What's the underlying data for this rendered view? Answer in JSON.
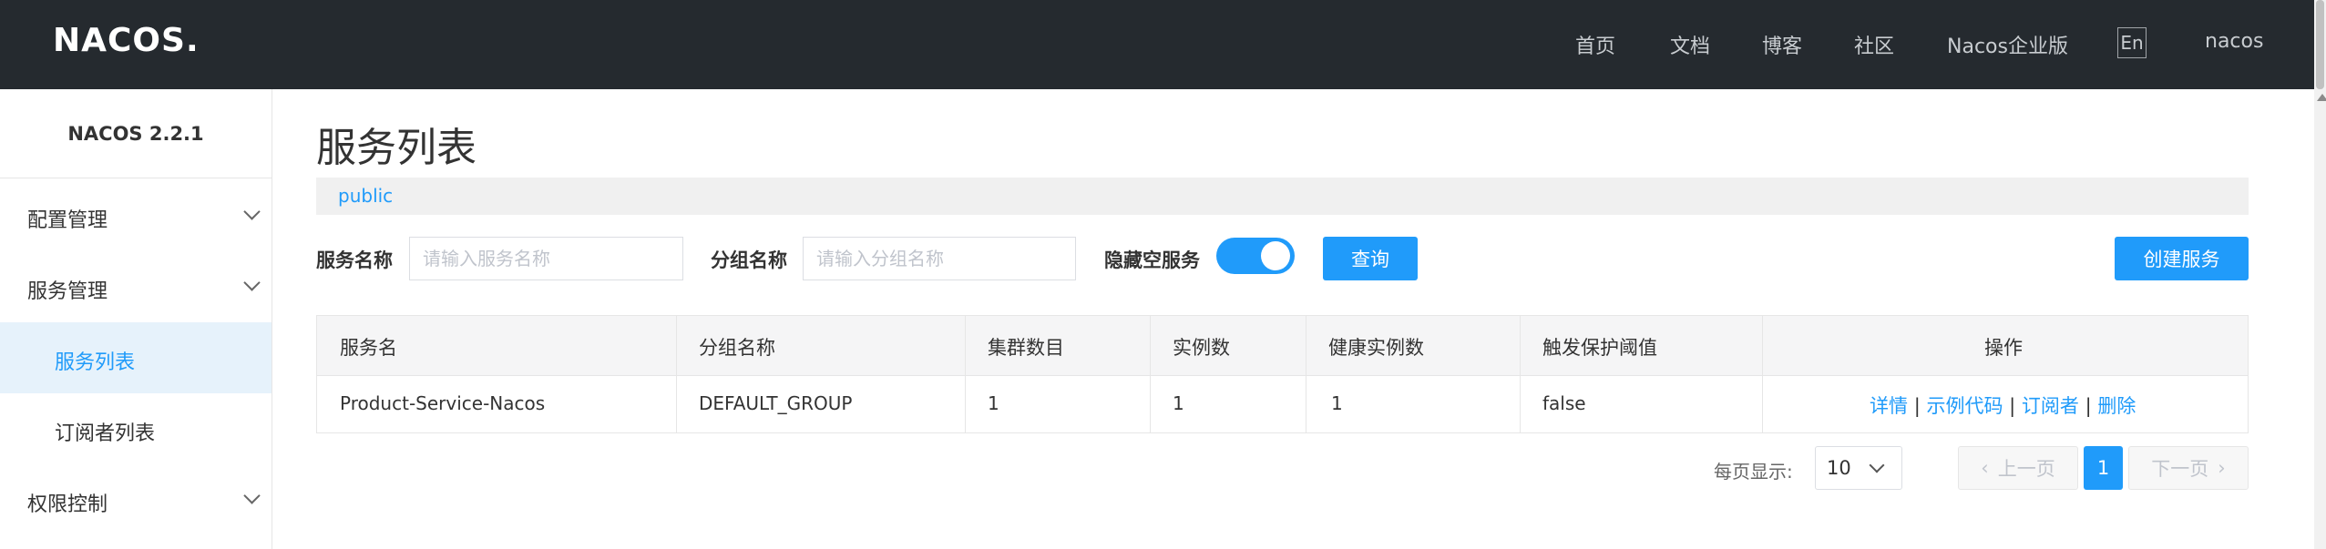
{
  "header": {
    "logo": "NACOS.",
    "nav": [
      "首页",
      "文档",
      "博客",
      "社区",
      "Nacos企业版"
    ],
    "lang": "En",
    "user": "nacos"
  },
  "sidebar": {
    "version": "NACOS 2.2.1",
    "items": [
      {
        "label": "配置管理"
      },
      {
        "label": "服务管理"
      },
      {
        "label": "服务列表"
      },
      {
        "label": "订阅者列表"
      },
      {
        "label": "权限控制"
      }
    ]
  },
  "main": {
    "title": "服务列表",
    "namespace": "public",
    "filters": {
      "service_label": "服务名称",
      "service_placeholder": "请输入服务名称",
      "group_label": "分组名称",
      "group_placeholder": "请输入分组名称",
      "hide_empty_label": "隐藏空服务",
      "hide_empty_on": true,
      "query_button": "查询",
      "create_button": "创建服务"
    },
    "table": {
      "headers": [
        "服务名",
        "分组名称",
        "集群数目",
        "实例数",
        "健康实例数",
        "触发保护阈值",
        "操作"
      ],
      "rows": [
        {
          "service": "Product-Service-Nacos",
          "group": "DEFAULT_GROUP",
          "clusters": "1",
          "instances": "1",
          "healthy": "1",
          "threshold": "false",
          "actions": [
            "详情",
            "示例代码",
            "订阅者",
            "删除"
          ],
          "sep": "|"
        }
      ]
    },
    "pagination": {
      "per_page_label": "每页显示:",
      "per_page": "10",
      "prev": "上一页",
      "current": "1",
      "next": "下一页"
    }
  },
  "colors": {
    "header_bg": "#252a2f",
    "accent": "#209bfa",
    "active_bg": "#e6f2fb"
  }
}
